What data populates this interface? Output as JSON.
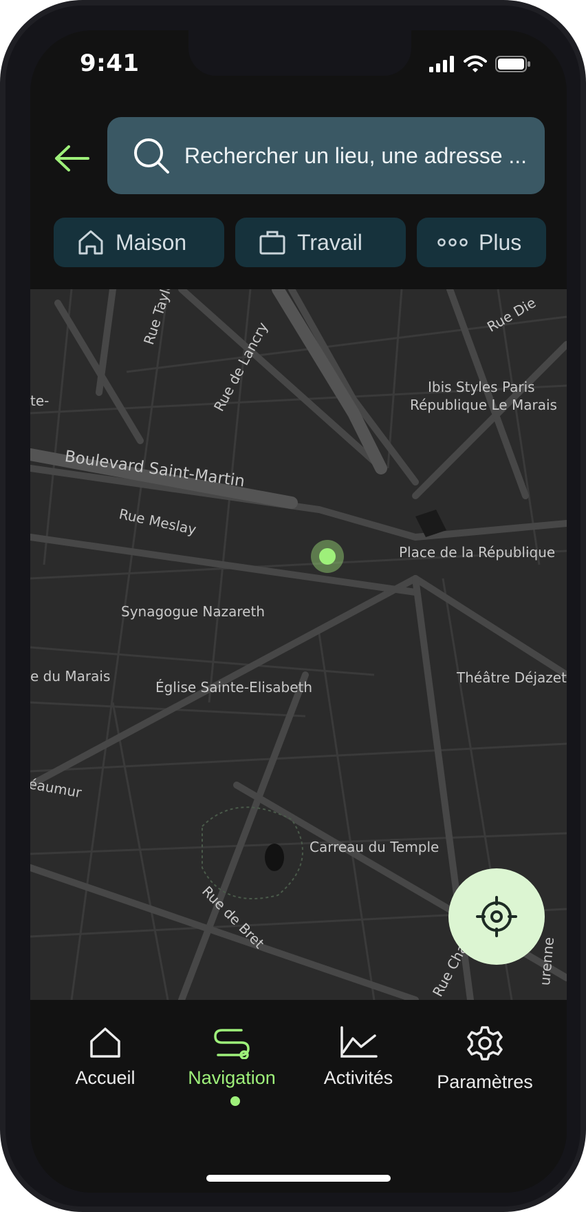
{
  "status_bar": {
    "time": "9:41"
  },
  "search": {
    "placeholder": "Rechercher un lieu, une adresse ..."
  },
  "chips": [
    {
      "label": "Maison",
      "icon": "home-icon"
    },
    {
      "label": "Travail",
      "icon": "briefcase-icon"
    },
    {
      "label": "Plus",
      "icon": "more-icon"
    }
  ],
  "map": {
    "labels": {
      "rue_taylor": "Rue Taylor",
      "rue_de_lancry": "Rue de Lancry",
      "rue_die": "Rue Die",
      "ibis_line1": "Ibis Styles Paris",
      "ibis_line2": "République Le Marais",
      "te": "te-",
      "boulevard": "Boulevard Saint-Martin",
      "rue_meslay": "Rue Meslay",
      "place_republique": "Place de la République",
      "synagogue": "Synagogue Nazareth",
      "du_marais": "e du Marais",
      "eglise": "Église Sainte-Elisabeth",
      "theatre": "Théâtre Déjazet",
      "reaumur": "éaumur",
      "carreau": "Carreau du Temple",
      "rue_de_bret": "Rue de Bret",
      "rue_cha": "Rue Cha",
      "turenne": "urenne"
    }
  },
  "tabbar": {
    "tabs": [
      {
        "label": "Accueil",
        "icon": "home-icon",
        "active": false
      },
      {
        "label": "Navigation",
        "icon": "route-icon",
        "active": true
      },
      {
        "label": "Activités",
        "icon": "chart-icon",
        "active": false
      },
      {
        "label": "Paramètres",
        "icon": "gear-icon",
        "active": false
      }
    ]
  },
  "colors": {
    "accent": "#9ef07a",
    "search_bg": "#3a5864",
    "chip_bg": "#16323c",
    "map_bg": "#2b2b2b",
    "locate_bg": "#dcf5d2"
  }
}
